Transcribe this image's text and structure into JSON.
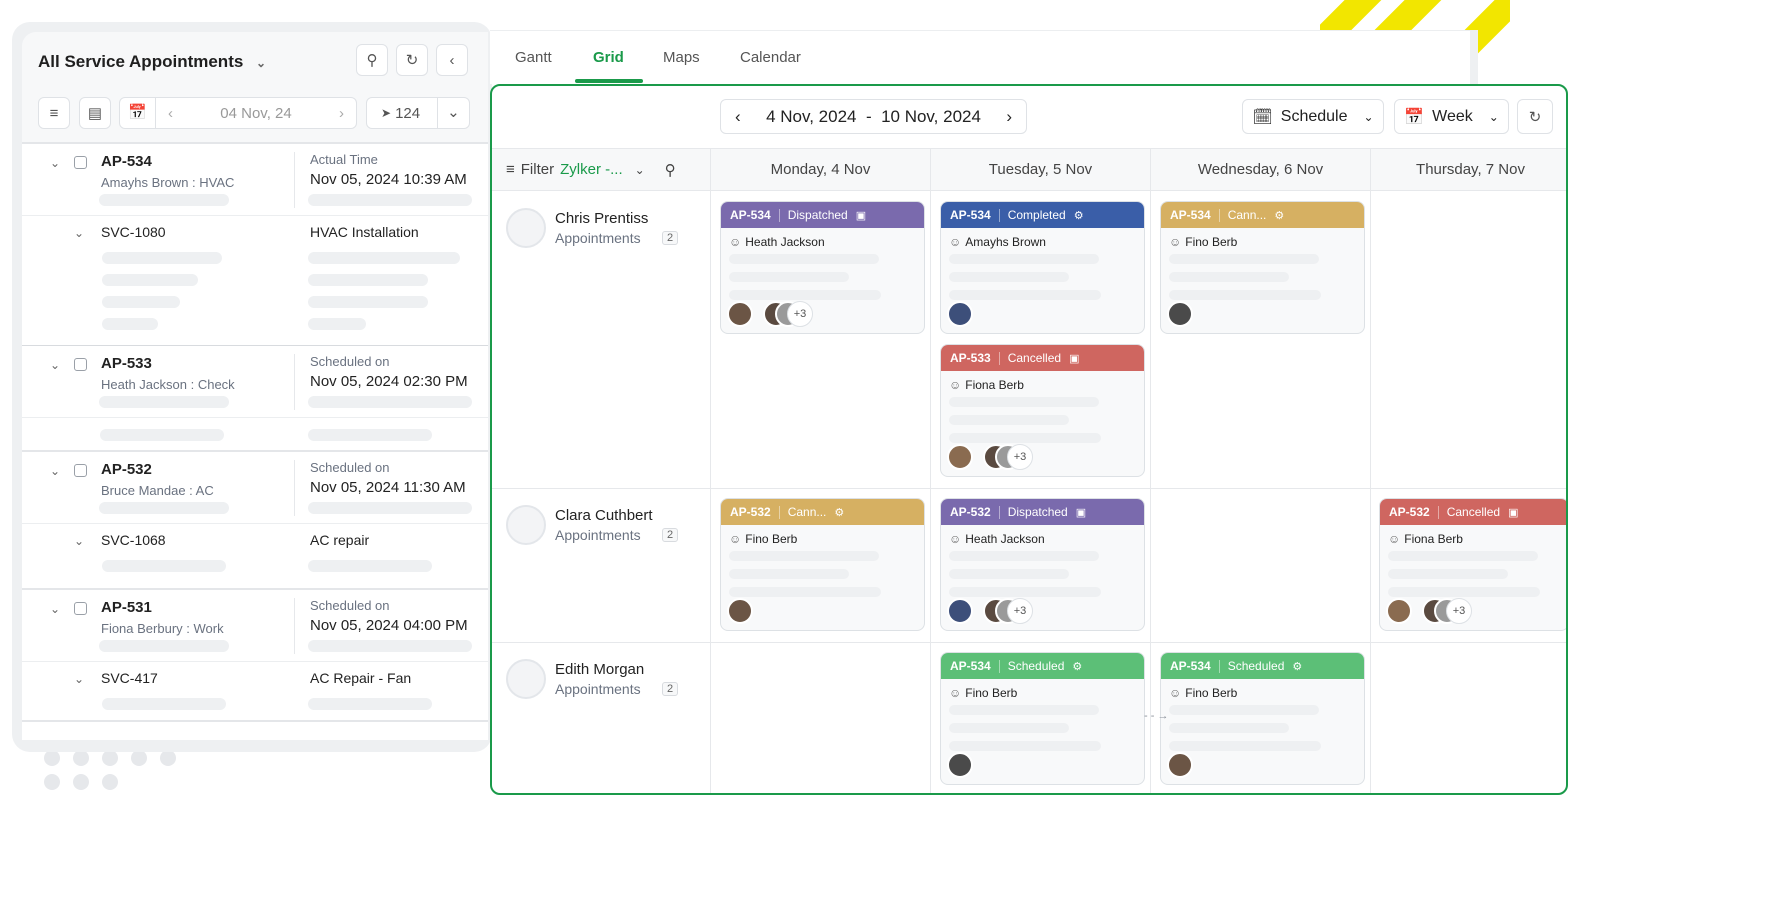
{
  "left_panel": {
    "title": "All Service Appointments",
    "date": "04 Nov, 24",
    "dispatch_count": "124",
    "items": [
      {
        "id": "AP-534",
        "sub": "Amayhs Brown : HVAC",
        "label": "Actual Time",
        "value": "Nov 05, 2024 10:39 AM",
        "child": {
          "id": "SVC-1080",
          "value": "HVAC Installation"
        }
      },
      {
        "id": "AP-533",
        "sub": "Heath Jackson : Check",
        "label": "Scheduled on",
        "value": "Nov 05, 2024 02:30 PM"
      },
      {
        "id": "AP-532",
        "sub": "Bruce Mandae : AC",
        "label": "Scheduled on",
        "value": "Nov 05, 2024 11:30 AM",
        "child": {
          "id": "SVC-1068",
          "value": "AC repair"
        }
      },
      {
        "id": "AP-531",
        "sub": "Fiona Berbury : Work",
        "label": "Scheduled on",
        "value": "Nov 05, 2024 04:00 PM",
        "child": {
          "id": "SVC-417",
          "value": "AC Repair - Fan"
        }
      }
    ]
  },
  "tabs": [
    "Gantt",
    "Grid",
    "Maps",
    "Calendar"
  ],
  "active_tab": "Grid",
  "grid": {
    "range_start": "4 Nov, 2024",
    "range_sep": "-",
    "range_end": "10 Nov, 2024",
    "view_mode": "Schedule",
    "period": "Week",
    "filter_label": "Filter",
    "filter_value": "Zylker -...",
    "days": [
      "Monday, 4 Nov",
      "Tuesday, 5 Nov",
      "Wednesday, 6 Nov",
      "Thursday, 7 Nov"
    ],
    "resources": [
      {
        "name": "Chris Prentiss",
        "label": "Appointments",
        "count": "2"
      },
      {
        "name": "Clara Cuthbert",
        "label": "Appointments",
        "count": "2"
      },
      {
        "name": "Edith Morgan",
        "label": "Appointments",
        "count": "2"
      }
    ],
    "status_colors": {
      "Dispatched": "#7a6aad",
      "Completed": "#3a5ea8",
      "Cancelled": "#cf6660",
      "Cann...": "#d6b062",
      "Scheduled": "#5cbf77"
    },
    "cards": [
      {
        "resource": 0,
        "day": 0,
        "slot": 0,
        "id": "AP-534",
        "status": "Dispatched",
        "icon": "calendar-icon",
        "person": "Heath Jackson",
        "extra": "+3"
      },
      {
        "resource": 0,
        "day": 1,
        "slot": 0,
        "id": "AP-534",
        "status": "Completed",
        "icon": "technician-icon",
        "person": "Amayhs Brown",
        "extra": ""
      },
      {
        "resource": 0,
        "day": 1,
        "slot": 1,
        "id": "AP-533",
        "status": "Cancelled",
        "icon": "calendar-icon",
        "person": "Fiona Berb",
        "extra": "+3"
      },
      {
        "resource": 0,
        "day": 2,
        "slot": 0,
        "id": "AP-534",
        "status": "Cann...",
        "icon": "technician-icon",
        "person": "Fino Berb",
        "extra": ""
      },
      {
        "resource": 1,
        "day": 0,
        "slot": 0,
        "id": "AP-532",
        "status": "Cann...",
        "icon": "technician-icon",
        "person": "Fino Berb",
        "extra": ""
      },
      {
        "resource": 1,
        "day": 1,
        "slot": 0,
        "id": "AP-532",
        "status": "Dispatched",
        "icon": "calendar-icon",
        "person": "Heath Jackson",
        "extra": "+3"
      },
      {
        "resource": 1,
        "day": 3,
        "slot": 0,
        "id": "AP-532",
        "status": "Cancelled",
        "icon": "calendar-icon",
        "person": "Fiona Berb",
        "extra": "+3"
      },
      {
        "resource": 2,
        "day": 1,
        "slot": 0,
        "id": "AP-534",
        "status": "Scheduled",
        "icon": "technician-icon",
        "person": "Fino Berb",
        "extra": ""
      },
      {
        "resource": 2,
        "day": 2,
        "slot": 0,
        "id": "AP-534",
        "status": "Scheduled",
        "icon": "technician-icon",
        "person": "Fino Berb",
        "extra": ""
      }
    ]
  }
}
